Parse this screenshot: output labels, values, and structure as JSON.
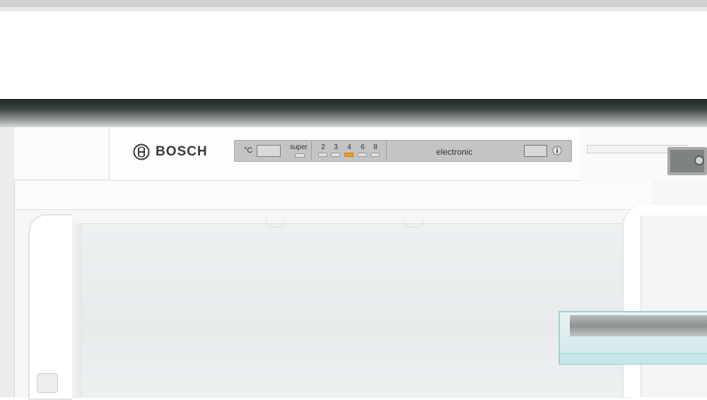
{
  "brand": {
    "name": "BOSCH"
  },
  "control_panel": {
    "temp_unit": "°C",
    "super_label": "super",
    "levels": [
      "2",
      "3",
      "4",
      "6",
      "8"
    ],
    "active_level": "4",
    "mode_label": "electronic"
  },
  "colors": {
    "active_indicator": "#f29a2e",
    "panel_strip": "#c3c4c5",
    "door_shelf_edge": "#9fd1d8"
  },
  "icons": [
    "bosch-logo-icon",
    "info-icon"
  ]
}
